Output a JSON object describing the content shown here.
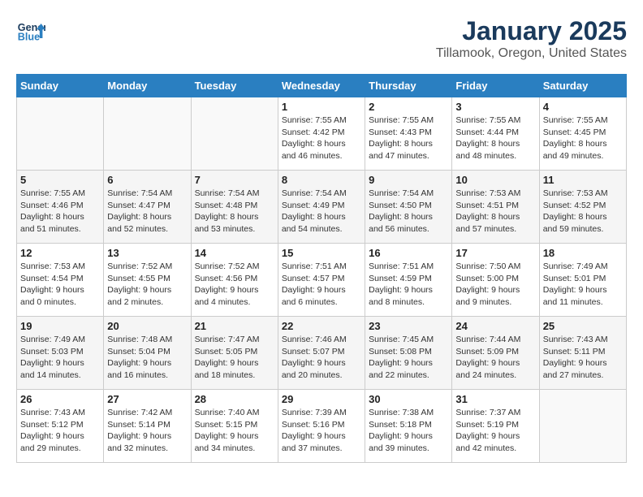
{
  "header": {
    "logo_line1": "General",
    "logo_line2": "Blue",
    "title": "January 2025",
    "subtitle": "Tillamook, Oregon, United States"
  },
  "days_of_week": [
    "Sunday",
    "Monday",
    "Tuesday",
    "Wednesday",
    "Thursday",
    "Friday",
    "Saturday"
  ],
  "weeks": [
    [
      {
        "day": "",
        "info": ""
      },
      {
        "day": "",
        "info": ""
      },
      {
        "day": "",
        "info": ""
      },
      {
        "day": "1",
        "info": "Sunrise: 7:55 AM\nSunset: 4:42 PM\nDaylight: 8 hours\nand 46 minutes."
      },
      {
        "day": "2",
        "info": "Sunrise: 7:55 AM\nSunset: 4:43 PM\nDaylight: 8 hours\nand 47 minutes."
      },
      {
        "day": "3",
        "info": "Sunrise: 7:55 AM\nSunset: 4:44 PM\nDaylight: 8 hours\nand 48 minutes."
      },
      {
        "day": "4",
        "info": "Sunrise: 7:55 AM\nSunset: 4:45 PM\nDaylight: 8 hours\nand 49 minutes."
      }
    ],
    [
      {
        "day": "5",
        "info": "Sunrise: 7:55 AM\nSunset: 4:46 PM\nDaylight: 8 hours\nand 51 minutes."
      },
      {
        "day": "6",
        "info": "Sunrise: 7:54 AM\nSunset: 4:47 PM\nDaylight: 8 hours\nand 52 minutes."
      },
      {
        "day": "7",
        "info": "Sunrise: 7:54 AM\nSunset: 4:48 PM\nDaylight: 8 hours\nand 53 minutes."
      },
      {
        "day": "8",
        "info": "Sunrise: 7:54 AM\nSunset: 4:49 PM\nDaylight: 8 hours\nand 54 minutes."
      },
      {
        "day": "9",
        "info": "Sunrise: 7:54 AM\nSunset: 4:50 PM\nDaylight: 8 hours\nand 56 minutes."
      },
      {
        "day": "10",
        "info": "Sunrise: 7:53 AM\nSunset: 4:51 PM\nDaylight: 8 hours\nand 57 minutes."
      },
      {
        "day": "11",
        "info": "Sunrise: 7:53 AM\nSunset: 4:52 PM\nDaylight: 8 hours\nand 59 minutes."
      }
    ],
    [
      {
        "day": "12",
        "info": "Sunrise: 7:53 AM\nSunset: 4:54 PM\nDaylight: 9 hours\nand 0 minutes."
      },
      {
        "day": "13",
        "info": "Sunrise: 7:52 AM\nSunset: 4:55 PM\nDaylight: 9 hours\nand 2 minutes."
      },
      {
        "day": "14",
        "info": "Sunrise: 7:52 AM\nSunset: 4:56 PM\nDaylight: 9 hours\nand 4 minutes."
      },
      {
        "day": "15",
        "info": "Sunrise: 7:51 AM\nSunset: 4:57 PM\nDaylight: 9 hours\nand 6 minutes."
      },
      {
        "day": "16",
        "info": "Sunrise: 7:51 AM\nSunset: 4:59 PM\nDaylight: 9 hours\nand 8 minutes."
      },
      {
        "day": "17",
        "info": "Sunrise: 7:50 AM\nSunset: 5:00 PM\nDaylight: 9 hours\nand 9 minutes."
      },
      {
        "day": "18",
        "info": "Sunrise: 7:49 AM\nSunset: 5:01 PM\nDaylight: 9 hours\nand 11 minutes."
      }
    ],
    [
      {
        "day": "19",
        "info": "Sunrise: 7:49 AM\nSunset: 5:03 PM\nDaylight: 9 hours\nand 14 minutes."
      },
      {
        "day": "20",
        "info": "Sunrise: 7:48 AM\nSunset: 5:04 PM\nDaylight: 9 hours\nand 16 minutes."
      },
      {
        "day": "21",
        "info": "Sunrise: 7:47 AM\nSunset: 5:05 PM\nDaylight: 9 hours\nand 18 minutes."
      },
      {
        "day": "22",
        "info": "Sunrise: 7:46 AM\nSunset: 5:07 PM\nDaylight: 9 hours\nand 20 minutes."
      },
      {
        "day": "23",
        "info": "Sunrise: 7:45 AM\nSunset: 5:08 PM\nDaylight: 9 hours\nand 22 minutes."
      },
      {
        "day": "24",
        "info": "Sunrise: 7:44 AM\nSunset: 5:09 PM\nDaylight: 9 hours\nand 24 minutes."
      },
      {
        "day": "25",
        "info": "Sunrise: 7:43 AM\nSunset: 5:11 PM\nDaylight: 9 hours\nand 27 minutes."
      }
    ],
    [
      {
        "day": "26",
        "info": "Sunrise: 7:43 AM\nSunset: 5:12 PM\nDaylight: 9 hours\nand 29 minutes."
      },
      {
        "day": "27",
        "info": "Sunrise: 7:42 AM\nSunset: 5:14 PM\nDaylight: 9 hours\nand 32 minutes."
      },
      {
        "day": "28",
        "info": "Sunrise: 7:40 AM\nSunset: 5:15 PM\nDaylight: 9 hours\nand 34 minutes."
      },
      {
        "day": "29",
        "info": "Sunrise: 7:39 AM\nSunset: 5:16 PM\nDaylight: 9 hours\nand 37 minutes."
      },
      {
        "day": "30",
        "info": "Sunrise: 7:38 AM\nSunset: 5:18 PM\nDaylight: 9 hours\nand 39 minutes."
      },
      {
        "day": "31",
        "info": "Sunrise: 7:37 AM\nSunset: 5:19 PM\nDaylight: 9 hours\nand 42 minutes."
      },
      {
        "day": "",
        "info": ""
      }
    ]
  ]
}
